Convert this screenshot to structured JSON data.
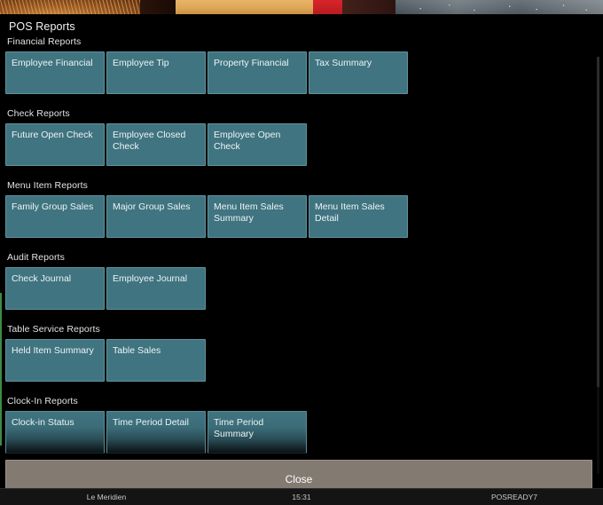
{
  "window": {
    "title": "POS Reports"
  },
  "decoration": {
    "top_strip_name": "background-image-strip"
  },
  "groups": [
    {
      "title": "Financial Reports",
      "tiles": [
        {
          "label": "Employee Financial"
        },
        {
          "label": "Employee Tip"
        },
        {
          "label": "Property Financial"
        },
        {
          "label": "Tax Summary"
        }
      ]
    },
    {
      "title": "Check Reports",
      "tiles": [
        {
          "label": "Future Open Check"
        },
        {
          "label": "Employee Closed Check"
        },
        {
          "label": "Employee Open Check"
        }
      ]
    },
    {
      "title": "Menu Item Reports",
      "tiles": [
        {
          "label": "Family Group Sales"
        },
        {
          "label": "Major Group Sales"
        },
        {
          "label": "Menu Item Sales Summary"
        },
        {
          "label": "Menu Item Sales Detail"
        }
      ]
    },
    {
      "title": "Audit Reports",
      "tiles": [
        {
          "label": "Check Journal"
        },
        {
          "label": "Employee Journal"
        }
      ]
    },
    {
      "title": "Table Service Reports",
      "tiles": [
        {
          "label": "Held Item Summary"
        },
        {
          "label": "Table Sales"
        }
      ]
    },
    {
      "title": "Clock-In Reports",
      "tiles": [
        {
          "label": "Clock-in Status"
        },
        {
          "label": "Time Period Detail"
        },
        {
          "label": "Time Period Summary"
        }
      ]
    }
  ],
  "footer": {
    "close_label": "Close"
  },
  "status_bar": {
    "property": "Le Meridien",
    "time": "15:31",
    "workstation": "POSREADY7"
  },
  "colors": {
    "tile_fill": "#3f7480",
    "tile_border": "#5f939d",
    "close_fill": "#837a72",
    "background": "#000000",
    "scroll_indicator": "#3f8b3f"
  }
}
